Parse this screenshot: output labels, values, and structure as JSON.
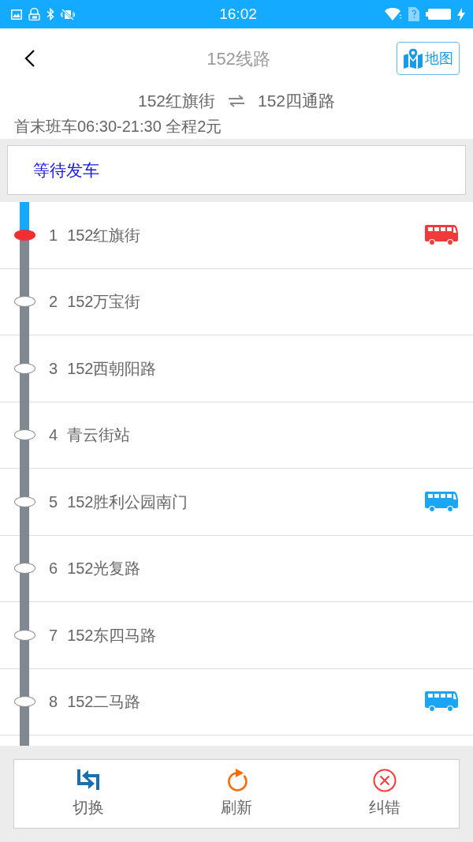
{
  "status_bar": {
    "time": "16:02"
  },
  "header": {
    "title": "152线路",
    "map_button": "地图"
  },
  "route": {
    "from": "152红旗街",
    "to": "152四通路",
    "info": "首末班车06:30-21:30 全程2元"
  },
  "status_message": "等待发车",
  "stops": [
    {
      "number": "1",
      "name": "152红旗街",
      "current": true,
      "bus": {
        "color": "#f23a3a"
      }
    },
    {
      "number": "2",
      "name": "152万宝街",
      "current": false
    },
    {
      "number": "3",
      "name": "152西朝阳路",
      "current": false
    },
    {
      "number": "4",
      "name": "青云街站",
      "current": false
    },
    {
      "number": "5",
      "name": "152胜利公园南门",
      "current": false,
      "bus": {
        "color": "#1aa6f5"
      }
    },
    {
      "number": "6",
      "name": "152光复路",
      "current": false
    },
    {
      "number": "7",
      "name": "152东四马路",
      "current": false
    },
    {
      "number": "8",
      "name": "152二马路",
      "current": false,
      "bus": {
        "color": "#1aa6f5"
      }
    }
  ],
  "toolbar": [
    {
      "kind": "switch",
      "label": "切换"
    },
    {
      "kind": "refresh",
      "label": "刷新"
    },
    {
      "kind": "report",
      "label": "纠错"
    }
  ]
}
